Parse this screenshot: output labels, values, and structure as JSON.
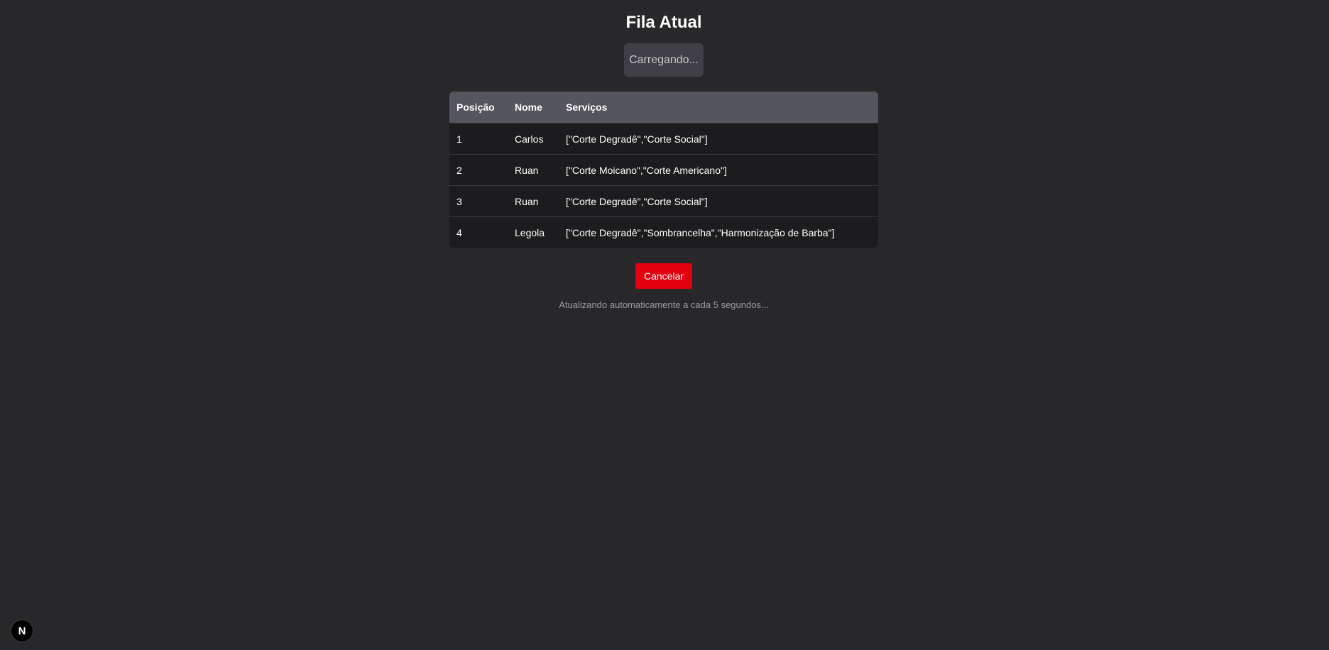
{
  "page": {
    "title": "Fila Atual",
    "status": "Carregando...",
    "cancel_label": "Cancelar",
    "auto_refresh_note": "Atualizando automaticamente a cada 5 segundos...",
    "badge_letter": "N"
  },
  "table": {
    "headers": [
      "Posição",
      "Nome",
      "Serviços"
    ],
    "rows": [
      [
        "1",
        "Carlos",
        "[\"Corte Degradê\",\"Corte Social\"]"
      ],
      [
        "2",
        "Ruan",
        "[\"Corte Moicano\",\"Corte Americano\"]"
      ],
      [
        "3",
        "Ruan",
        "[\"Corte Degradê\",\"Corte Social\"]"
      ],
      [
        "4",
        "Legola",
        "[\"Corte Degradê\",\"Sombrancelha\",\"Harmonização de Barba\"]"
      ]
    ]
  },
  "colors": {
    "background": "#28282a",
    "header_bg": "#55555d",
    "row_bg": "#1c1c1e",
    "status_bg": "#3f3f45",
    "cancel_bg": "#e3000f",
    "note_text": "#9a9aa0"
  },
  "icons": {
    "badge": "nextjs-logo-icon"
  }
}
